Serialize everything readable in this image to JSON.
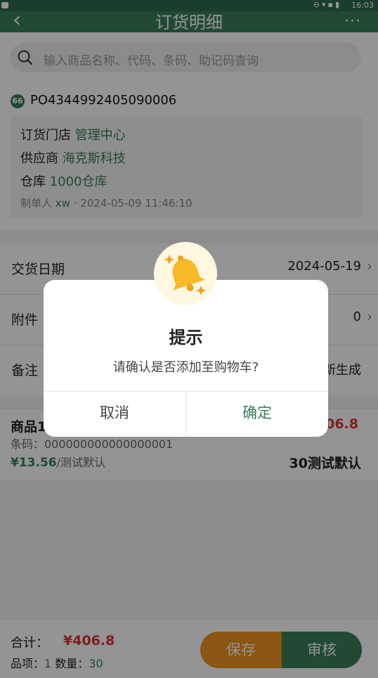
{
  "status_bar": {
    "time": "16:03"
  },
  "nav": {
    "back_icon": "‹",
    "title": "订货明细",
    "more_icon": "···"
  },
  "search": {
    "placeholder": "输入商品名称、代码、条码、助记码查询"
  },
  "order": {
    "po_icon": "66",
    "po_number": "PO4344992405090006",
    "store_label": "订货门店",
    "store_value": "管理中心",
    "supplier_label": "供应商",
    "supplier_value": "海克斯科技",
    "warehouse_label": "仓库",
    "warehouse_value": "1000仓库",
    "creator_label": "制单人",
    "creator_value": "xw",
    "created_at": "· 2024-05-09 11:46:10"
  },
  "rows": {
    "delivery_label": "交货日期",
    "delivery_value": "2024-05-19",
    "attach_label": "附件",
    "attach_value": "0",
    "note_label": "备注",
    "note_value": "新生成"
  },
  "product": {
    "name": "商品1",
    "total": "406.8",
    "barcode": "条码：000000000000000001",
    "price": "¥13.56",
    "unit": "/测试默认",
    "qty": "30测试默认"
  },
  "bottom": {
    "sum_label": "合计：",
    "sum_value": "¥406.8",
    "items_label": "品项：",
    "items_value": "1",
    "qty_label": "数量：",
    "qty_value": "30",
    "save_label": "保存",
    "audit_label": "审核"
  },
  "dialog": {
    "title": "提示",
    "message": "请确认是否添加至购物车?",
    "cancel_label": "取消",
    "ok_label": "确定"
  },
  "colors": {
    "accent": "#3a7f5a",
    "warning": "#f0941e",
    "price": "#dd3333"
  }
}
